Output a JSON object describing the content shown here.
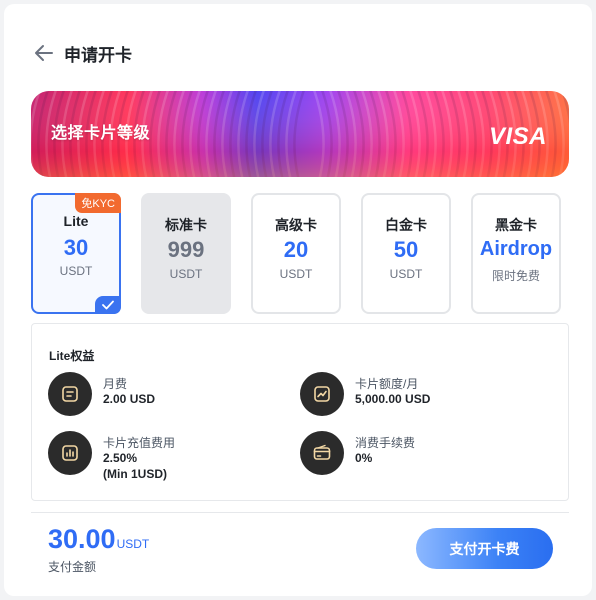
{
  "header": {
    "title": "申请开卡"
  },
  "banner": {
    "title": "选择卡片等级",
    "brand": "VISA"
  },
  "tiers": [
    {
      "name": "Lite",
      "price": "30",
      "unit": "USDT",
      "badge": "免KYC",
      "selected": true
    },
    {
      "name": "标准卡",
      "price": "999",
      "unit": "USDT",
      "disabled": true
    },
    {
      "name": "高级卡",
      "price": "20",
      "unit": "USDT"
    },
    {
      "name": "白金卡",
      "price": "50",
      "unit": "USDT"
    },
    {
      "name": "黑金卡",
      "price": "Airdrop",
      "unit": "限时免费"
    }
  ],
  "benefits": {
    "title": "Lite权益",
    "items": [
      {
        "label": "月费",
        "value": "2.00 USD",
        "icon": "document-icon"
      },
      {
        "label": "卡片额度/月",
        "value": "5,000.00 USD",
        "icon": "chart-line-icon"
      },
      {
        "label": "卡片充值费用",
        "value": "2.50%",
        "value2": "(Min 1USD)",
        "icon": "bar-chart-icon"
      },
      {
        "label": "消费手续费",
        "value": "0%",
        "icon": "card-icon"
      }
    ]
  },
  "footer": {
    "amount": "30.00",
    "unit": "USDT",
    "label": "支付金额",
    "pay_label": "支付开卡费"
  },
  "colors": {
    "accent": "#2f6cf5",
    "badge": "#f26a2f",
    "icon_bg": "#2b2b2b",
    "icon_fg": "#f3d8a5"
  }
}
